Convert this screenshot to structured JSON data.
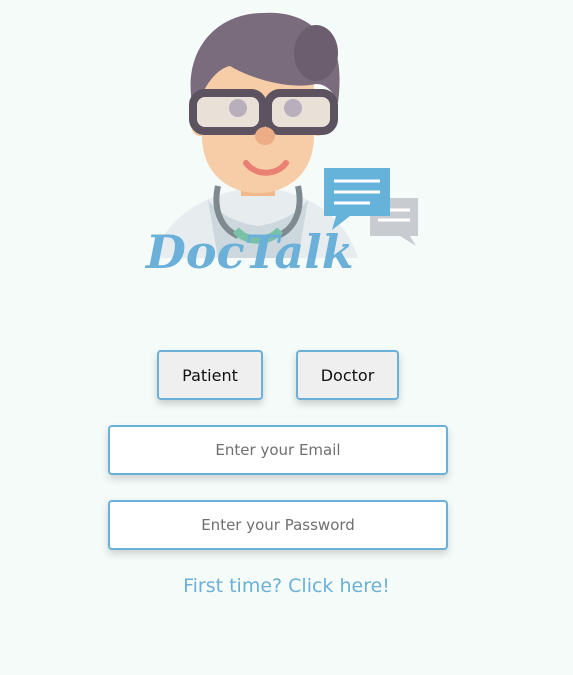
{
  "app": {
    "logo_text": "DocTalk"
  },
  "roles": {
    "patient_label": "Patient",
    "doctor_label": "Doctor"
  },
  "form": {
    "email_placeholder": "Enter your Email",
    "email_value": "",
    "password_placeholder": "Enter your Password",
    "password_value": ""
  },
  "links": {
    "signup": "First time? Click here!"
  },
  "colors": {
    "accent": "#6bb0d9",
    "background": "#f5fbf8",
    "button_bg": "#efefef",
    "logo_text": "#6bb0d9"
  },
  "icons": {
    "logo": "doctor-avatar-icon",
    "chat": "chat-bubble-icon"
  }
}
